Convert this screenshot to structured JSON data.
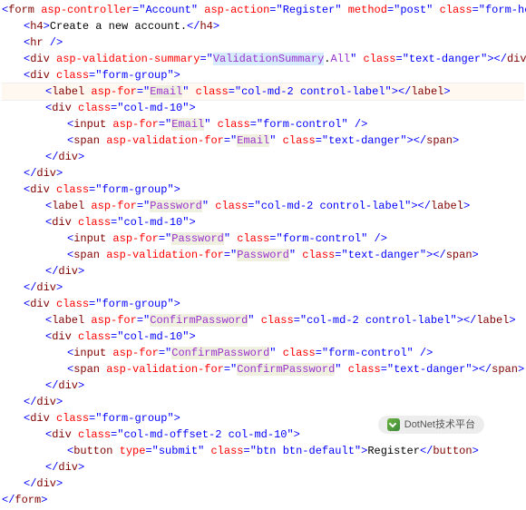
{
  "tokens": {
    "lt": "<",
    "gt": ">",
    "cl": "</",
    "sc": " />",
    "form": "form",
    "h4": "h4",
    "hr": "hr",
    "div": "div",
    "label": "label",
    "input": "input",
    "span": "span",
    "button": "button",
    "asp_controller": "asp-controller",
    "asp_action": "asp-action",
    "method": "method",
    "class": "class",
    "asp_validation_summary": "asp-validation-summary",
    "asp_for": "asp-for",
    "asp_validation_for": "asp-validation-for",
    "type": "type",
    "account": "Account",
    "register": "Register",
    "post": "post",
    "form_hori": "form-hori",
    "create_txt": "Create a new account.",
    "vs_prefix": "ValidationSummary",
    "vs_dot": ".",
    "vs_all": "All",
    "text_danger": "text-danger",
    "form_group": "form-group",
    "col_md_2_ctrl": "col-md-2 control-label",
    "col_md_10": "col-md-10",
    "form_control": "form-control",
    "off2_10": "col-md-offset-2 col-md-10",
    "submit": "submit",
    "btn_default": "btn btn-default",
    "email": "Email",
    "password": "Password",
    "confirm": "ConfirmPassword",
    "reg_txt": "Register",
    "eq": "=",
    "q": "\""
  },
  "overlay": "DotNet技术平台"
}
